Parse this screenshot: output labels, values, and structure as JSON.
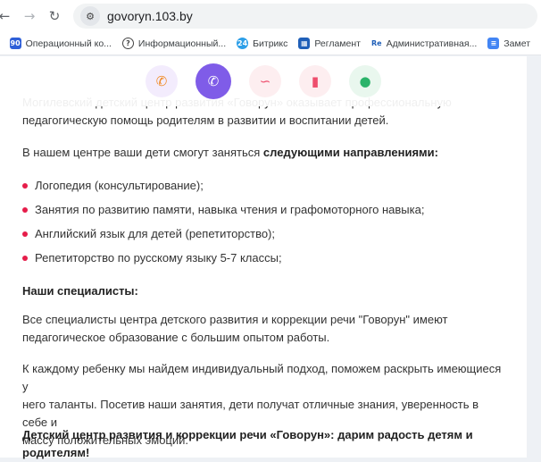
{
  "browser": {
    "url": "govoryn.103.by"
  },
  "bookmarks": [
    {
      "label": "Операционный ко...",
      "icon": "operational-icon",
      "color": "#2e5fd8",
      "glyph": "90"
    },
    {
      "label": "Информационный...",
      "icon": "info-icon",
      "color": "#444444",
      "glyph": "?"
    },
    {
      "label": "Битрикс",
      "icon": "bitrix-icon",
      "color": "#2d9fe8",
      "glyph": "24"
    },
    {
      "label": "Регламент",
      "icon": "reglament-icon",
      "color": "#1f5fb8",
      "glyph": "▦"
    },
    {
      "label": "Административная...",
      "icon": "admin-icon",
      "color": "#1f5fb8",
      "glyph": "Re"
    },
    {
      "label": "Замет",
      "icon": "notes-icon",
      "color": "#4285f4",
      "glyph": "≡"
    }
  ],
  "share": {
    "phone": "✆",
    "viber": "✆",
    "link": "∽",
    "bookmark": "▮",
    "chat": "●"
  },
  "article": {
    "intro_line1": "Могилевский детский центр развития «Говорун» оказывает профессиональную",
    "intro_line2": "педагогическую помощь родителям в развитии и воспитании детей.",
    "directions_prefix": "В нашем центре ваши дети смогут заняться ",
    "directions_bold": "следующими направлениями:",
    "list": [
      "Логопедия (консультирование);",
      "Занятия по развитию памяти, навыка чтения и графомоторного навыка;",
      "Английский язык для детей (репетиторство);",
      "Репетиторство по русскому языку 5-7 классы;"
    ],
    "specialists_heading": "Наши специалисты:",
    "specialists_line1": "Все специалисты центра детского развития и коррекции речи \"Говорун\" имеют",
    "specialists_line2": "педагогическое образование с большим опытом работы.",
    "approach_line1": "К каждому ребенку мы найдем индивидуальный подход, поможем раскрыть имеющиеся у",
    "approach_line2": "него таланты. Посетив наши занятия, дети получат отличные знания, уверенность в себе и",
    "approach_line3": "массу положительных эмоций.",
    "closing_line1": "Детский центр развития и коррекции речи «Говорун»: дарим радость детям и",
    "closing_line2": "родителям!"
  }
}
